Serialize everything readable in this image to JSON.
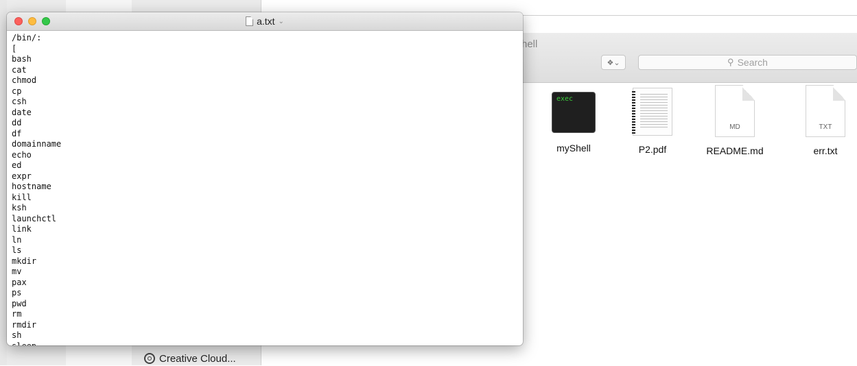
{
  "editor": {
    "title": "a.txt",
    "chevron": "⌄",
    "lines": [
      "/bin/:",
      "[",
      "bash",
      "cat",
      "chmod",
      "cp",
      "csh",
      "date",
      "dd",
      "df",
      "domainname",
      "echo",
      "ed",
      "expr",
      "hostname",
      "kill",
      "ksh",
      "launchctl",
      "link",
      "ln",
      "ls",
      "mkdir",
      "mv",
      "pax",
      "ps",
      "pwd",
      "rm",
      "rmdir",
      "sh",
      "sleep"
    ]
  },
  "finder": {
    "title_fragment": "hell",
    "search_placeholder": "Search",
    "dropbox_icon": "dropbox-icon",
    "files": [
      {
        "name": "myShell",
        "kind": "exec",
        "label": "exec"
      },
      {
        "name": "P2.pdf",
        "kind": "pdf",
        "label": ""
      },
      {
        "name": "README.md",
        "kind": "doc",
        "label": "MD"
      },
      {
        "name": "err.txt",
        "kind": "doc",
        "label": "TXT"
      }
    ]
  },
  "sidebar": {
    "creative_cloud_label": "Creative Cloud..."
  },
  "colors": {
    "close": "#fc605c",
    "minimize": "#fdbc40",
    "maximize": "#34c84a",
    "exec_text": "#3ccd3c"
  }
}
